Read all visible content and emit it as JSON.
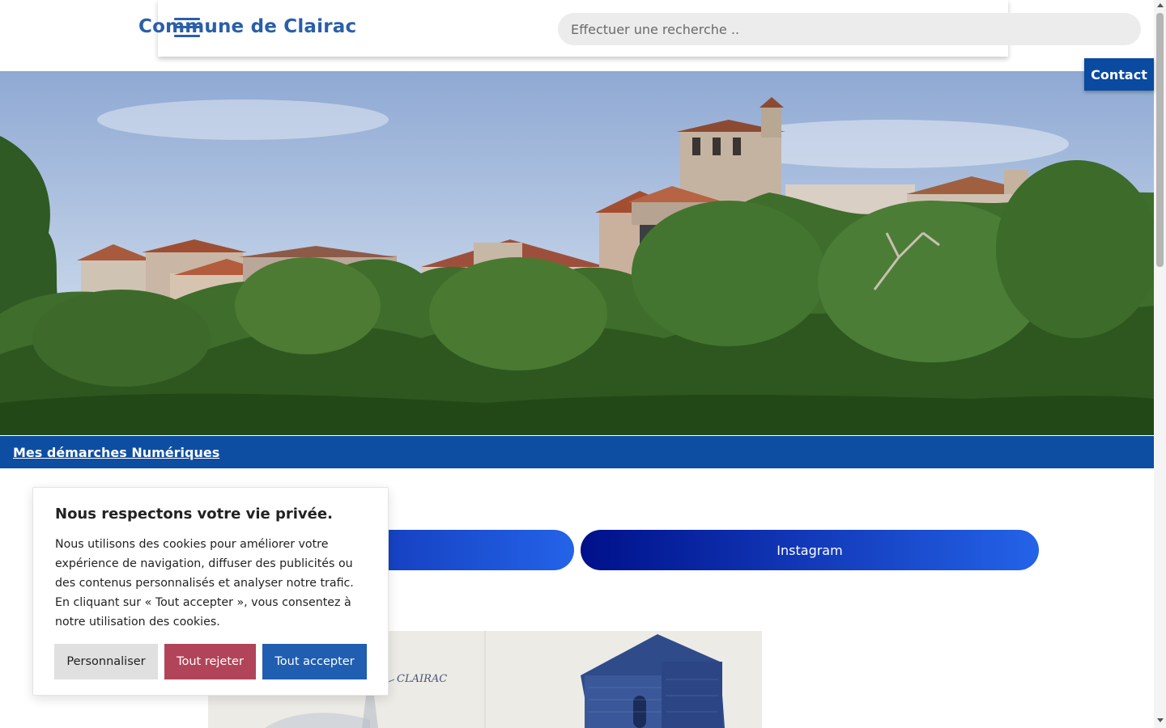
{
  "header": {
    "site_title": "Commune de Clairac",
    "search_placeholder": "Effectuer une recherche .."
  },
  "contact_button": "Contact",
  "hero": {
    "image_description": "Clairac hilltop buildings above trees"
  },
  "demarches_link": "Mes démarches Numériques",
  "social": {
    "facebook": "",
    "instagram": "Instagram"
  },
  "illustration": {
    "caption_text": "CLAIRAC"
  },
  "cookie_banner": {
    "title": "Nous respectons votre vie privée.",
    "text": "Nous utilisons des cookies pour améliorer votre expérience de navigation, diffuser des publicités ou des contenus personnalisés et analyser notre trafic. En cliquant sur « Tout accepter », vous consentez à notre utilisation des cookies.",
    "btn_customize": "Personnaliser",
    "btn_reject": "Tout rejeter",
    "btn_accept": "Tout accepter"
  },
  "colors": {
    "brand_blue": "#2a5fa8",
    "bar_blue": "#0d4ea3",
    "reject_red": "#b24459",
    "accept_blue": "#1f5eb0"
  }
}
